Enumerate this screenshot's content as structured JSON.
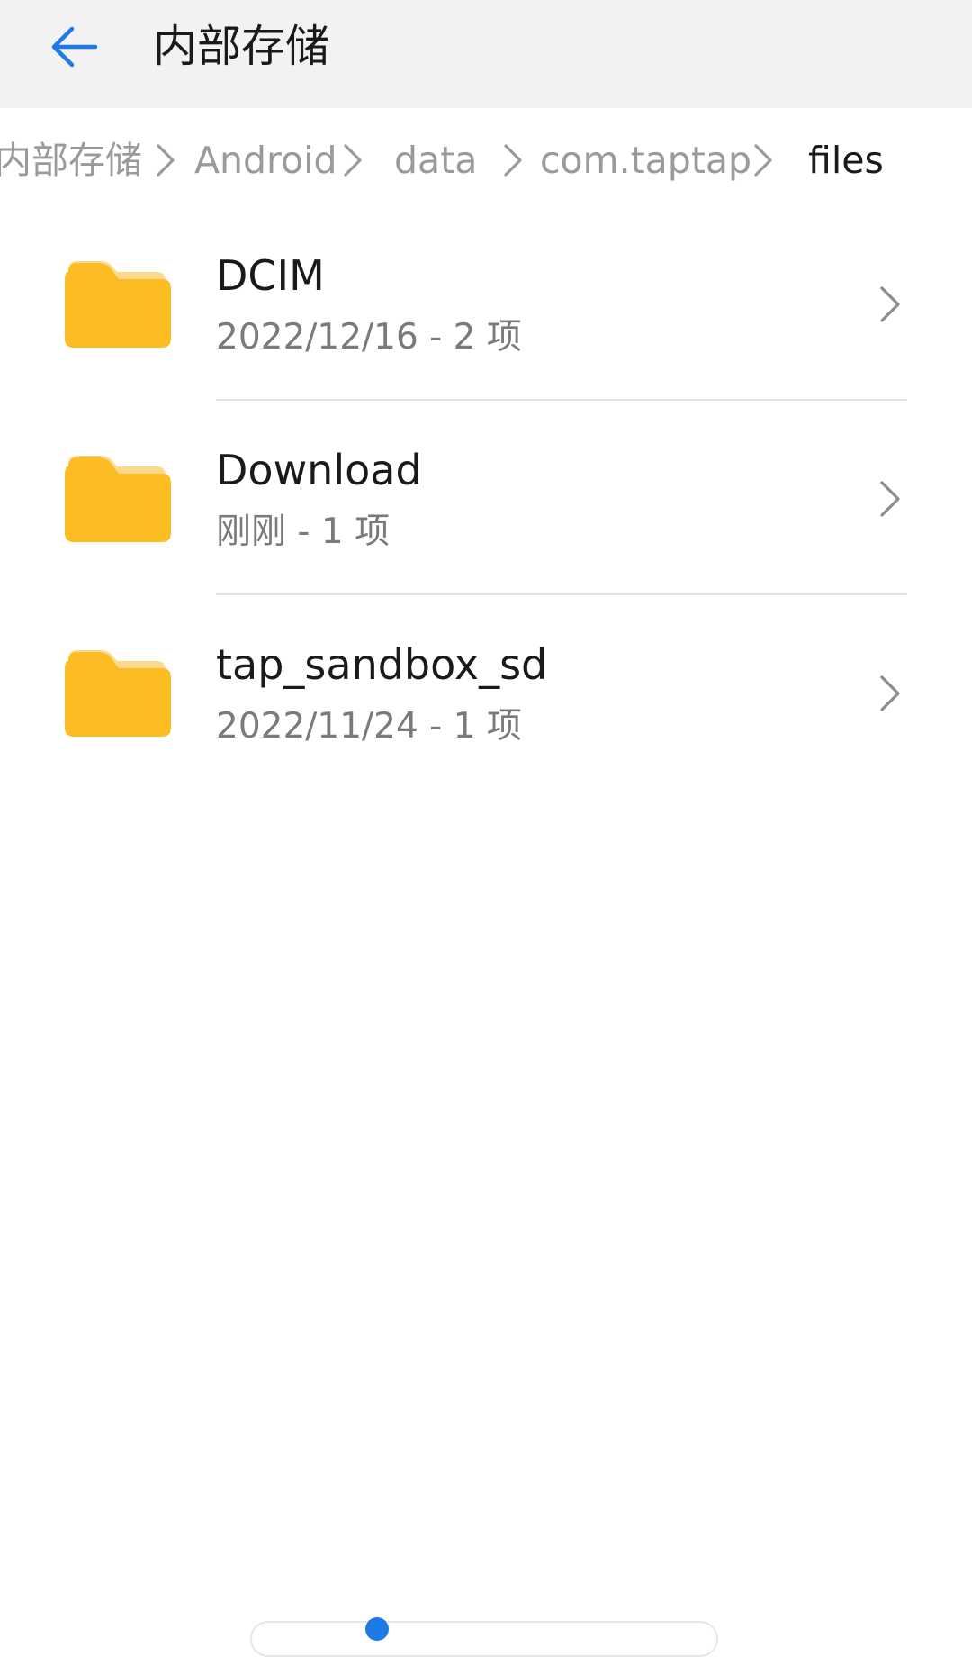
{
  "header": {
    "title": "内部存储",
    "back_icon": "back-arrow-icon",
    "accent_color": "#1e7be6"
  },
  "breadcrumb": {
    "items": [
      {
        "label": "内部存储"
      },
      {
        "label": "Android"
      },
      {
        "label": "data"
      },
      {
        "label": "com.taptap"
      },
      {
        "label": "files"
      }
    ]
  },
  "folders": [
    {
      "name": "DCIM",
      "meta": "2022/12/16 - 2 项"
    },
    {
      "name": "Download",
      "meta": "刚刚 - 1 项"
    },
    {
      "name": "tap_sandbox_sd",
      "meta": "2022/11/24 - 1 项"
    }
  ],
  "colors": {
    "folder": "#fbbc24",
    "folder_tab": "#fdd98c"
  }
}
